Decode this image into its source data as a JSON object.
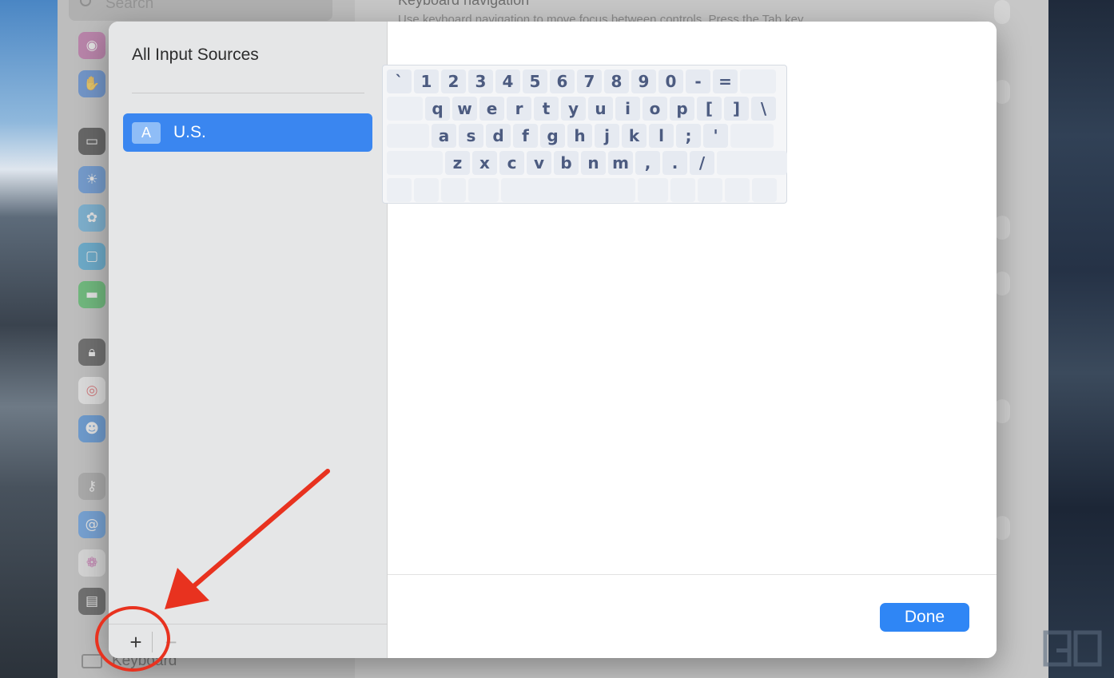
{
  "background": {
    "search_placeholder": "Search",
    "heading": "Keyboard navigation",
    "description": "Use keyboard navigation to move focus between controls. Press the Tab key",
    "keyboard_item_label": "Keyboard"
  },
  "input_sources": {
    "title": "All Input Sources",
    "items": [
      {
        "badge": "A",
        "label": "U.S.",
        "selected": true
      }
    ],
    "add_label": "+",
    "remove_label": "−"
  },
  "keyboard_layout": {
    "rows": [
      [
        "`",
        "1",
        "2",
        "3",
        "4",
        "5",
        "6",
        "7",
        "8",
        "9",
        "0",
        "-",
        "="
      ],
      [
        "q",
        "w",
        "e",
        "r",
        "t",
        "y",
        "u",
        "i",
        "o",
        "p",
        "[",
        "]",
        "\\"
      ],
      [
        "a",
        "s",
        "d",
        "f",
        "g",
        "h",
        "j",
        "k",
        "l",
        ";",
        "'"
      ],
      [
        "z",
        "x",
        "c",
        "v",
        "b",
        "n",
        "m",
        ",",
        ".",
        "/"
      ]
    ]
  },
  "done_label": "Done",
  "colors": {
    "accent": "#2f86f5",
    "selection": "#3a86f0",
    "annotation": "#e8321f"
  },
  "background_icons": [
    "siri-icon",
    "hand-icon",
    "display-icon",
    "brightness-icon",
    "flower-icon",
    "screen-icon",
    "battery-icon",
    "lock-icon",
    "fingerprint-icon",
    "users-icon",
    "key-icon",
    "at-icon",
    "game-center-icon",
    "wallet-icon"
  ]
}
